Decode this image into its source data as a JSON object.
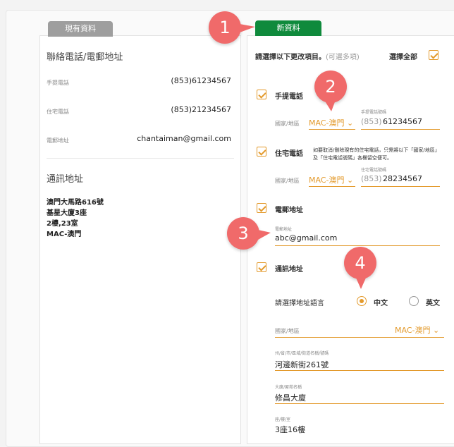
{
  "tabs": {
    "current": "現有資料",
    "new": "新資料"
  },
  "left": {
    "contact_heading": "聯絡電話/電郵地址",
    "rows": [
      {
        "label": "手提電話",
        "value": "(853)61234567"
      },
      {
        "label": "住宅電話",
        "value": "(853)21234567"
      },
      {
        "label": "電郵地址",
        "value": "chantaiman@gmail.com"
      }
    ],
    "address_heading": "通訊地址",
    "address_lines": [
      "澳門大馬路616號",
      "基星大廈3座",
      "2樓,23室",
      "MAC-澳門"
    ]
  },
  "right": {
    "instruction": "請選擇以下更改項目。",
    "instruction_hint": "(可選多項)",
    "select_all": "選擇全部",
    "mobile": {
      "label": "手提電話",
      "region_label": "國家/地區",
      "region_value": "MAC-澳門",
      "phone_label": "手提電話號碼",
      "prefix": "(853)",
      "number": "61234567"
    },
    "home": {
      "label": "住宅電話",
      "note": "如要取消/刪除現有的住宅電話，只需將以下「國家/地區」及「住宅電話號碼」各欄留空便可。",
      "region_label": "國家/地區",
      "region_value": "MAC-澳門",
      "phone_label": "住宅電話號碼",
      "prefix": "(853)",
      "number": "28234567"
    },
    "email": {
      "label": "電郵地址",
      "field_label": "電郵地址",
      "value": "abc@gmail.com"
    },
    "address": {
      "label": "通訊地址",
      "lang_prompt": "請選擇地址語言",
      "lang_zh": "中文",
      "lang_en": "英文",
      "region_label": "國家/地區",
      "region_value": "MAC-澳門",
      "street_label": "州/省/市/區域/街道名稱/號碼",
      "street_value": "河邊新街261號",
      "building_label": "大廈/屋苑名稱",
      "building_value": "修昌大廈",
      "floor_label": "座/樓/室",
      "floor_value": "3座16樓"
    }
  },
  "markers": [
    "1",
    "2",
    "3",
    "4"
  ],
  "colors": {
    "accent": "#e39a2c",
    "tab_green": "#0f8a3c",
    "tab_grey": "#9e9e9e",
    "marker": "#f06a6a"
  }
}
